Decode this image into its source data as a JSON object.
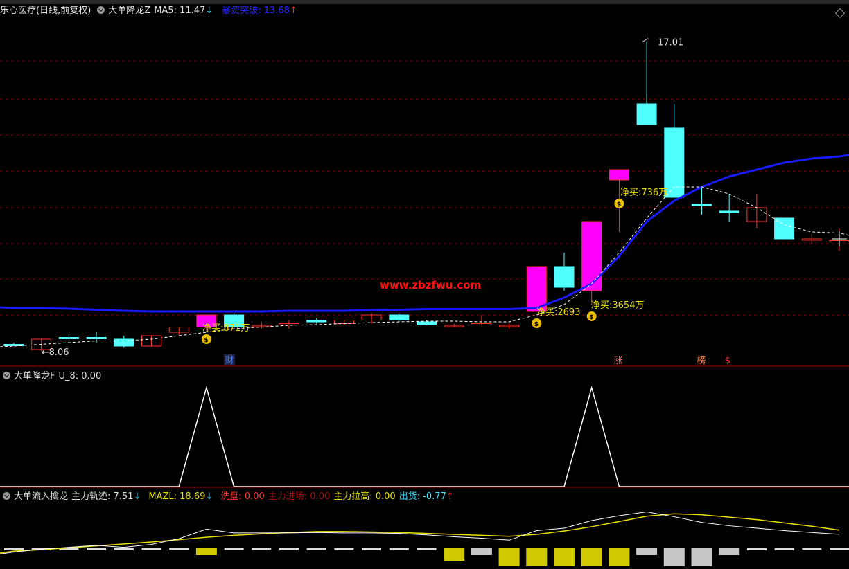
{
  "main_header": {
    "stock": "乐心医疗(日线,前复权)",
    "indicator": "大单降龙Z",
    "ma5_label": "MA5: 11.47",
    "ma5_arrow": "↓",
    "breakout_label": "暴资突破: 13.68",
    "breakout_arrow": "↑"
  },
  "watermark": "www.zbzfwu.com",
  "annotations": {
    "high": "17.01",
    "low": "8.06",
    "net_buys": [
      "净买:871万",
      "净买:2693",
      "净买:3654万",
      "净买:736万"
    ],
    "badges": [
      "财",
      "涨",
      "榜",
      "$"
    ]
  },
  "panel2_header": {
    "name": "大单降龙F",
    "value": "U_8: 0.00"
  },
  "panel3_header": {
    "name": "大单流入擒龙",
    "track": "主力轨迹: 7.51",
    "track_arrow": "↓",
    "mazl": "MAZL: 18.69",
    "mazl_arrow": "↓",
    "wash": "洗盘: 0.00",
    "enter": "主力进场: 0.00",
    "lift": "主力拉高: 0.00",
    "ship": "出货: -0.77",
    "ship_arrow": "↑"
  },
  "colors": {
    "up": "#ff3030",
    "down": "#50ffff",
    "limit_up": "#ff00ff",
    "ma_blue": "#1a1aff",
    "ma_dash": "#ffffff",
    "gold": "#e8e000",
    "grid": "#8b0000"
  },
  "chart_data": {
    "type": "candlestick",
    "y_range": [
      7.6,
      17.6
    ],
    "candles": [
      {
        "o": 8.25,
        "h": 8.3,
        "l": 8.2,
        "c": 8.25,
        "kind": "down"
      },
      {
        "o": 8.1,
        "h": 8.4,
        "l": 8.06,
        "c": 8.4,
        "kind": "up"
      },
      {
        "o": 8.45,
        "h": 8.55,
        "l": 8.35,
        "c": 8.45,
        "kind": "down"
      },
      {
        "o": 8.45,
        "h": 8.6,
        "l": 8.3,
        "c": 8.45,
        "kind": "down"
      },
      {
        "o": 8.4,
        "h": 8.5,
        "l": 8.15,
        "c": 8.2,
        "kind": "down"
      },
      {
        "o": 8.2,
        "h": 8.5,
        "l": 8.2,
        "c": 8.5,
        "kind": "up"
      },
      {
        "o": 8.6,
        "h": 8.75,
        "l": 8.5,
        "c": 8.75,
        "kind": "up"
      },
      {
        "o": 8.75,
        "h": 9.1,
        "l": 8.65,
        "c": 9.1,
        "kind": "limit_up"
      },
      {
        "o": 9.1,
        "h": 9.2,
        "l": 8.7,
        "c": 8.75,
        "kind": "down"
      },
      {
        "o": 8.8,
        "h": 8.9,
        "l": 8.7,
        "c": 8.8,
        "kind": "up"
      },
      {
        "o": 8.85,
        "h": 8.95,
        "l": 8.7,
        "c": 8.85,
        "kind": "up"
      },
      {
        "o": 8.95,
        "h": 9.0,
        "l": 8.85,
        "c": 8.9,
        "kind": "down"
      },
      {
        "o": 8.85,
        "h": 8.95,
        "l": 8.8,
        "c": 8.95,
        "kind": "up"
      },
      {
        "o": 8.95,
        "h": 9.15,
        "l": 8.85,
        "c": 9.1,
        "kind": "up"
      },
      {
        "o": 9.1,
        "h": 9.15,
        "l": 8.9,
        "c": 8.95,
        "kind": "down"
      },
      {
        "o": 8.9,
        "h": 8.95,
        "l": 8.8,
        "c": 8.82,
        "kind": "down"
      },
      {
        "o": 8.8,
        "h": 8.85,
        "l": 8.75,
        "c": 8.8,
        "kind": "up"
      },
      {
        "o": 8.85,
        "h": 9.1,
        "l": 8.8,
        "c": 8.85,
        "kind": "up"
      },
      {
        "o": 8.8,
        "h": 8.85,
        "l": 8.7,
        "c": 8.78,
        "kind": "up"
      },
      {
        "o": 9.2,
        "h": 10.5,
        "l": 9.2,
        "c": 10.5,
        "kind": "limit_up"
      },
      {
        "o": 10.5,
        "h": 10.9,
        "l": 9.8,
        "c": 9.9,
        "kind": "down"
      },
      {
        "o": 9.8,
        "h": 11.8,
        "l": 9.4,
        "c": 11.8,
        "kind": "limit_up"
      },
      {
        "o": 13.0,
        "h": 13.0,
        "l": 11.5,
        "c": 13.3,
        "kind": "limit_up_open"
      },
      {
        "o": 15.2,
        "h": 17.01,
        "l": 14.6,
        "c": 14.6,
        "kind": "down"
      },
      {
        "o": 14.5,
        "h": 15.2,
        "l": 12.5,
        "c": 12.5,
        "kind": "down"
      },
      {
        "o": 12.3,
        "h": 12.8,
        "l": 12.0,
        "c": 12.3,
        "kind": "down"
      },
      {
        "o": 12.1,
        "h": 12.6,
        "l": 11.8,
        "c": 12.1,
        "kind": "down"
      },
      {
        "o": 11.8,
        "h": 12.6,
        "l": 11.6,
        "c": 12.2,
        "kind": "up"
      },
      {
        "o": 11.9,
        "h": 11.9,
        "l": 11.3,
        "c": 11.3,
        "kind": "down"
      },
      {
        "o": 11.3,
        "h": 11.45,
        "l": 11.15,
        "c": 11.3,
        "kind": "up"
      },
      {
        "o": 11.25,
        "h": 11.6,
        "l": 10.95,
        "c": 11.25,
        "kind": "up"
      }
    ],
    "ma_blue": [
      9.3,
      9.3,
      9.28,
      9.25,
      9.22,
      9.2,
      9.2,
      9.2,
      9.2,
      9.2,
      9.22,
      9.22,
      9.22,
      9.24,
      9.25,
      9.27,
      9.27,
      9.27,
      9.27,
      9.3,
      9.6,
      10.0,
      10.8,
      11.8,
      12.4,
      12.8,
      13.1,
      13.3,
      13.5,
      13.62,
      13.68
    ],
    "ma_dash": [
      8.2,
      8.25,
      8.3,
      8.35,
      8.35,
      8.4,
      8.5,
      8.6,
      8.7,
      8.75,
      8.8,
      8.82,
      8.85,
      8.88,
      8.9,
      8.92,
      8.92,
      8.9,
      8.9,
      9.1,
      9.4,
      10.0,
      10.9,
      11.9,
      12.8,
      12.8,
      12.6,
      12.2,
      11.7,
      11.5,
      11.47
    ],
    "u8": [
      0,
      0,
      0,
      0,
      0,
      0,
      0,
      1,
      0,
      0,
      0,
      0,
      0,
      0,
      0,
      0,
      0,
      0,
      0,
      0,
      0,
      1,
      0,
      0,
      0,
      0,
      0,
      0,
      0,
      0,
      0
    ],
    "track_white": [
      3.8,
      4.4,
      4.8,
      5.2,
      4.8,
      5.4,
      6.6,
      8.6,
      7.8,
      7.8,
      7.8,
      7.9,
      7.8,
      7.8,
      7.7,
      7.4,
      7.0,
      6.7,
      6.3,
      8.3,
      8.8,
      10.4,
      11.4,
      12.2,
      11.2,
      10.0,
      9.3,
      8.8,
      8.3,
      7.9,
      7.51
    ],
    "mazl_yellow": [
      4.0,
      4.3,
      4.7,
      5.1,
      5.5,
      5.9,
      6.4,
      6.9,
      7.3,
      7.6,
      7.9,
      8.1,
      8.1,
      8.0,
      7.9,
      7.7,
      7.5,
      7.3,
      7.1,
      7.5,
      8.2,
      9.1,
      10.2,
      11.3,
      11.8,
      11.6,
      11.1,
      10.6,
      9.9,
      9.2,
      8.4
    ],
    "bars": [
      0,
      0,
      0,
      0,
      0,
      0,
      0,
      1,
      0,
      0,
      0,
      0,
      0,
      0,
      0,
      0,
      2,
      3,
      4,
      4,
      4,
      4,
      4,
      3,
      5,
      5,
      3,
      0,
      0,
      0,
      0
    ]
  }
}
